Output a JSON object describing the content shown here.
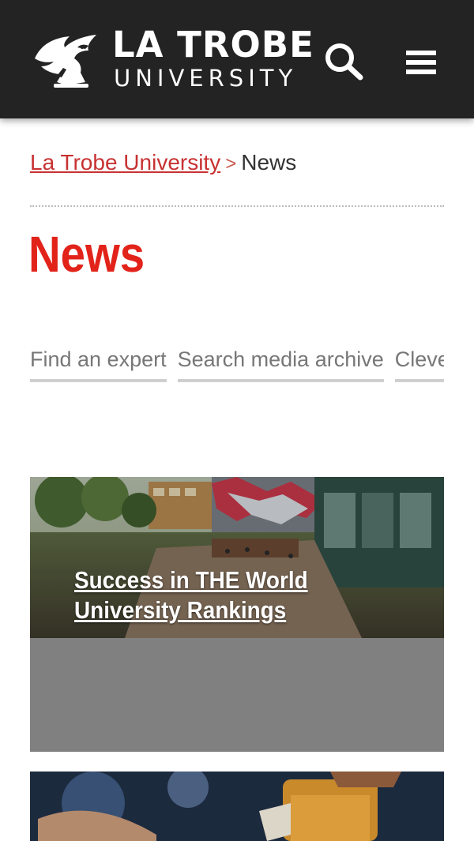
{
  "header": {
    "logo_line1": "LA TROBE",
    "logo_line2": "UNIVERSITY",
    "icons": {
      "logo": "eagle-crest-icon",
      "search": "search-icon",
      "menu": "hamburger-menu-icon"
    },
    "background": "#232323"
  },
  "breadcrumb": {
    "home": "La Trobe University",
    "separator": ">",
    "current": "News"
  },
  "page": {
    "title": "News",
    "accent": "#e2231a"
  },
  "tabs": [
    {
      "label": "Find an expert"
    },
    {
      "label": "Search media archive"
    },
    {
      "label": "Cleve"
    }
  ],
  "cards": [
    {
      "title": "Success in THE World University Rankings"
    }
  ]
}
